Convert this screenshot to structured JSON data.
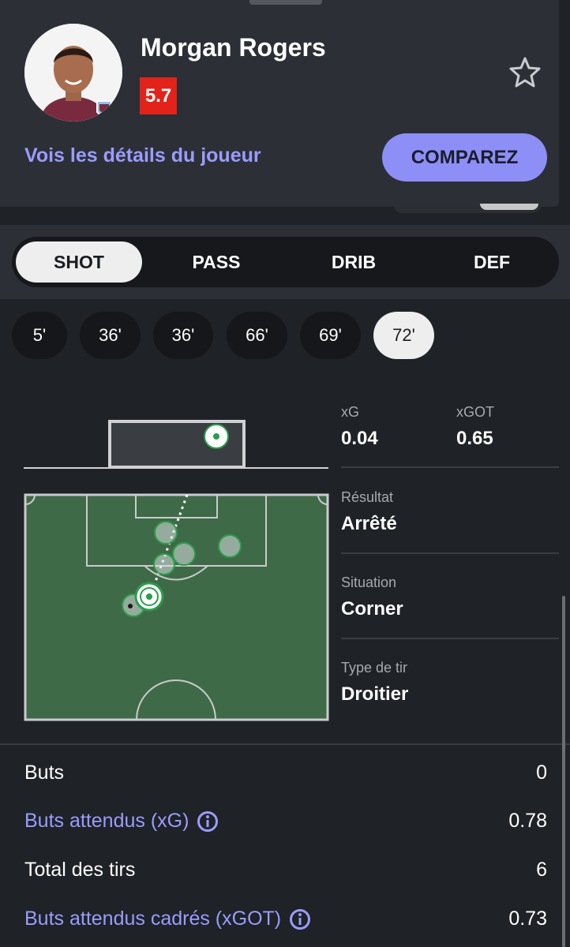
{
  "player": {
    "name": "Morgan Rogers",
    "rating": "5.7",
    "details_link": "Vois les détails du joueur",
    "compare_label": "COMPAREZ"
  },
  "tabs": [
    {
      "label": "SHOT",
      "active": true
    },
    {
      "label": "PASS",
      "active": false
    },
    {
      "label": "DRIB",
      "active": false
    },
    {
      "label": "DEF",
      "active": false
    }
  ],
  "minutes": [
    "5'",
    "36'",
    "36'",
    "66'",
    "69'",
    "72'"
  ],
  "selected_minute": "72'",
  "shot_detail": {
    "xg_label": "xG",
    "xg_value": "0.04",
    "xgot_label": "xGOT",
    "xgot_value": "0.65",
    "result_label": "Résultat",
    "result_value": "Arrêté",
    "situation_label": "Situation",
    "situation_value": "Corner",
    "shot_type_label": "Type de tir",
    "shot_type_value": "Droitier"
  },
  "summary": [
    {
      "label": "Buts",
      "value": "0",
      "link": false,
      "info": false
    },
    {
      "label": "Buts attendus (xG)",
      "value": "0.78",
      "link": true,
      "info": true
    },
    {
      "label": "Total des tirs",
      "value": "6",
      "link": false,
      "info": false
    },
    {
      "label": "Buts attendus cadrés (xGOT)",
      "value": "0.73",
      "link": true,
      "info": true
    }
  ],
  "colors": {
    "accent": "#8d8ff6",
    "link": "#9a9cff",
    "rating": "#e2231a",
    "pitch": "#3f6a47",
    "shot_marker": "#2a9d4a"
  }
}
